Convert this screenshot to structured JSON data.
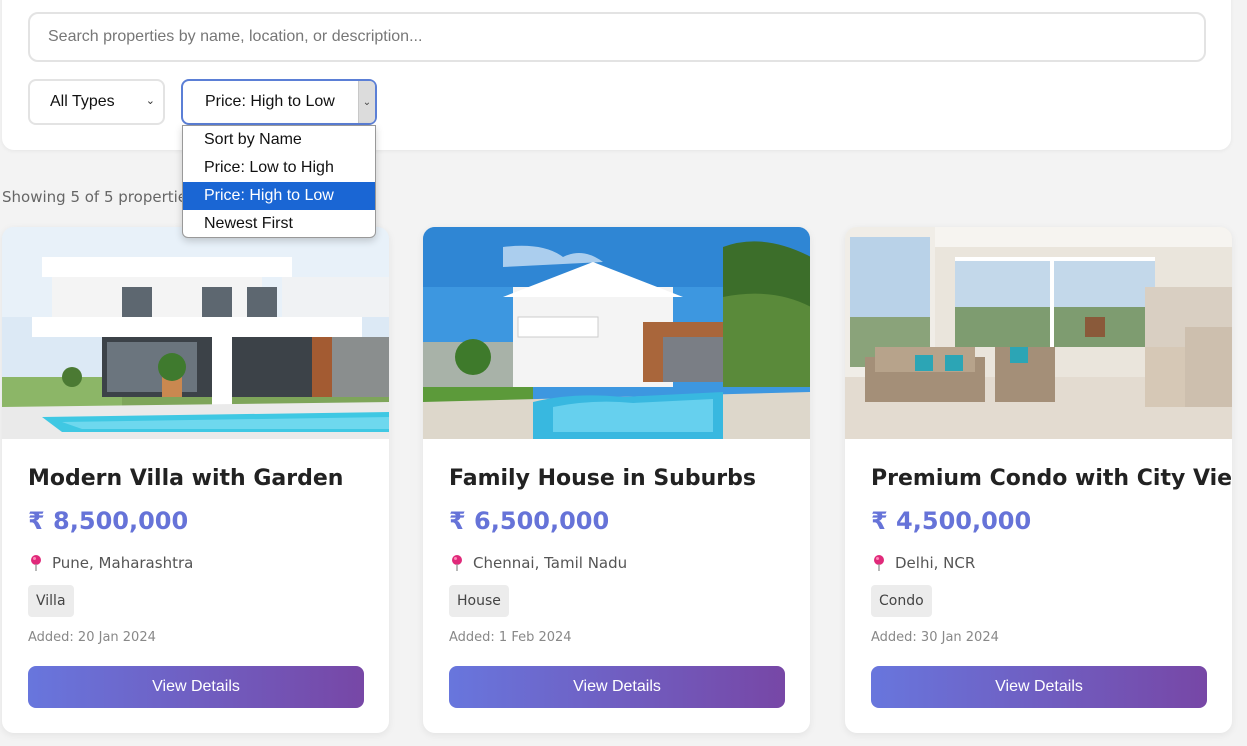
{
  "search": {
    "placeholder": "Search properties by name, location, or description..."
  },
  "filters": {
    "type_selected": "All Types",
    "sort_selected": "Price: High to Low",
    "sort_options": [
      "Sort by Name",
      "Price: Low to High",
      "Price: High to Low",
      "Newest First"
    ]
  },
  "results": {
    "count_text": "Showing 5 of 5 properties"
  },
  "properties": [
    {
      "title": "Modern Villa with Garden",
      "price": "₹ 8,500,000",
      "location": "Pune, Maharashtra",
      "type": "Villa",
      "added": "Added: 20 Jan 2024",
      "button": "View Details"
    },
    {
      "title": "Family House in Suburbs",
      "price": "₹ 6,500,000",
      "location": "Chennai, Tamil Nadu",
      "type": "House",
      "added": "Added: 1 Feb 2024",
      "button": "View Details"
    },
    {
      "title": "Premium Condo with City View",
      "price": "₹ 4,500,000",
      "location": "Delhi, NCR",
      "type": "Condo",
      "added": "Added: 30 Jan 2024",
      "button": "View Details"
    }
  ],
  "colors": {
    "accent": "#6673d8",
    "button_gradient_start": "#6876dd",
    "button_gradient_end": "#7747a6",
    "selected_option": "#1a66d4",
    "pin": "#e0297a"
  }
}
